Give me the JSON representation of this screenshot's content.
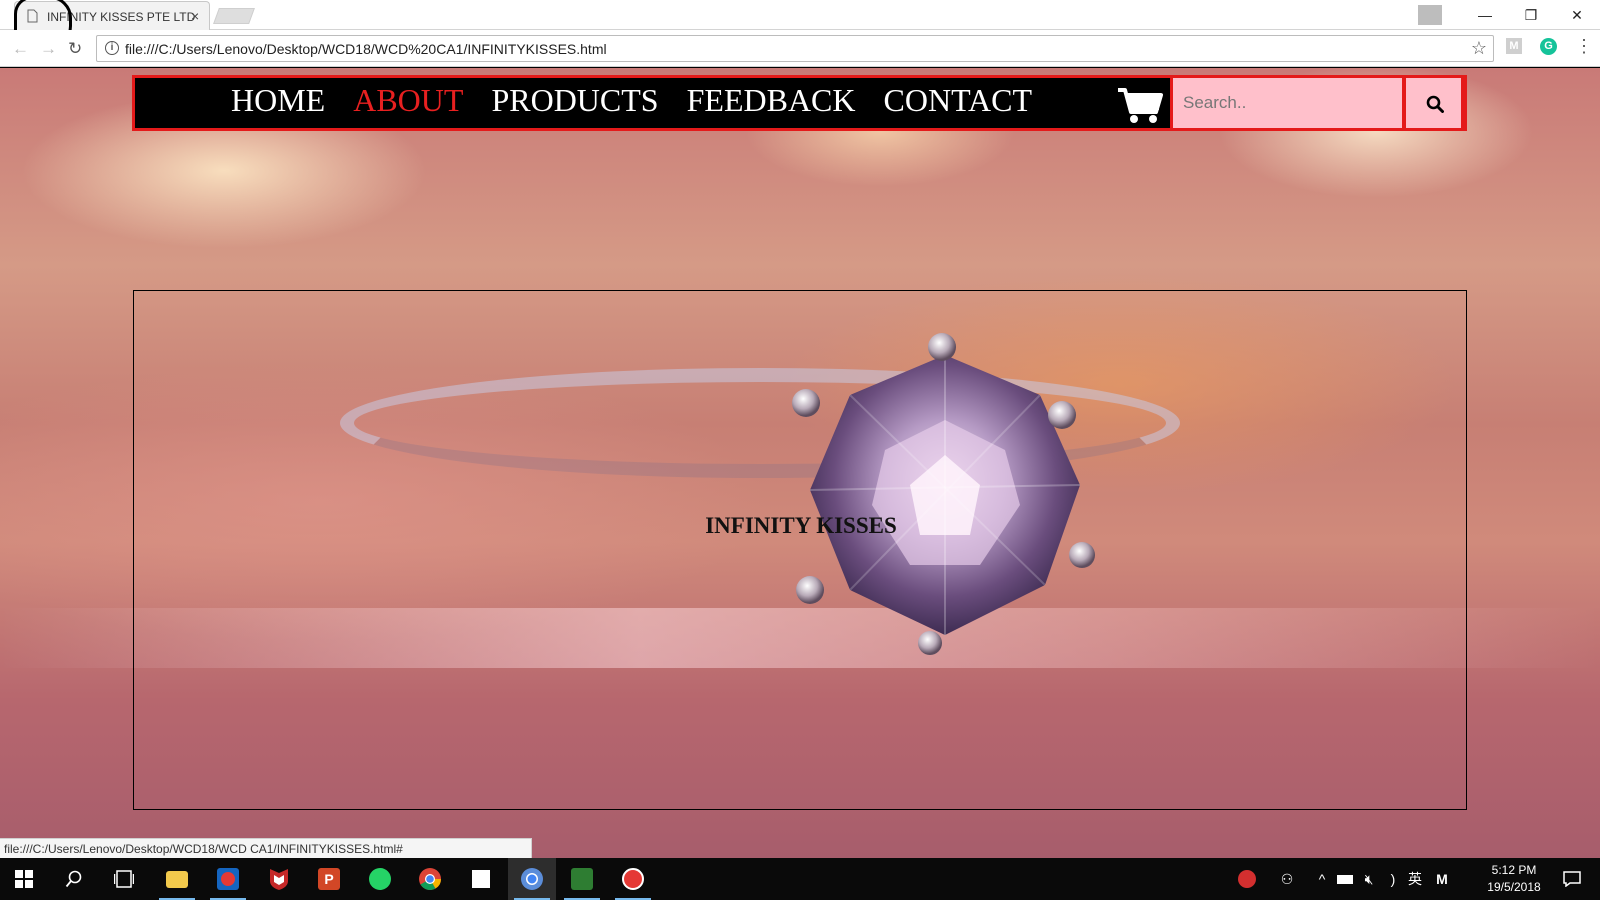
{
  "browser": {
    "tab_title": "INFINITY KISSES PTE LTD",
    "tab_close": "×",
    "url": "file:///C:/Users/Lenovo/Desktop/WCD18/WCD%20CA1/INFINITYKISSES.html",
    "status_url": "file:///C:/Users/Lenovo/Desktop/WCD18/WCD CA1/INFINITYKISSES.html#",
    "window_controls": {
      "minimize": "—",
      "restore": "❐",
      "close": "✕"
    },
    "extensions": {
      "m": "M",
      "g": "G"
    }
  },
  "site": {
    "nav": [
      {
        "label": "HOME",
        "active": false
      },
      {
        "label": "ABOUT",
        "active": true
      },
      {
        "label": "PRODUCTS",
        "active": false
      },
      {
        "label": "FEEDBACK",
        "active": false
      },
      {
        "label": "CONTACT",
        "active": false
      }
    ],
    "search_placeholder": "Search..",
    "hero_title": "INFINITY KISSES",
    "colors": {
      "nav_bg": "#000000",
      "nav_border": "#e41a1a",
      "active_link": "#e82020",
      "search_bg": "#ffc0cb"
    }
  },
  "taskbar": {
    "apps": [
      "windows-start-icon",
      "search-icon",
      "task-view-icon",
      "file-explorer-icon",
      "app-red-icon",
      "mcafee-icon",
      "powerpoint-icon",
      "whatsapp-icon",
      "chrome-icon",
      "sticky-notes-icon",
      "chrome-active-icon",
      "excel-icon",
      "app-seal-icon"
    ],
    "ime": "英",
    "time": "5:12 PM",
    "date": "19/5/2018"
  }
}
